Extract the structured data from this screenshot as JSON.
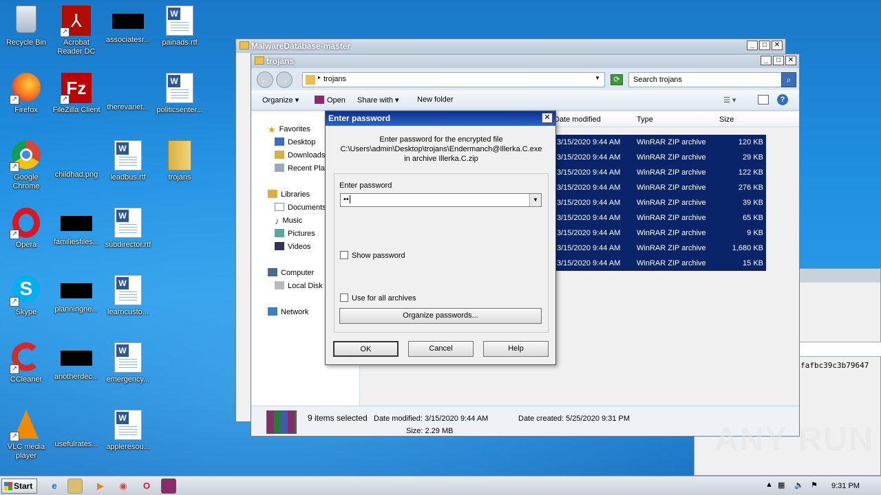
{
  "desktop_icons": [
    {
      "label": "Recycle Bin"
    },
    {
      "label": "Acrobat Reader DC"
    },
    {
      "label": "associatesr..."
    },
    {
      "label": "painads.rtf"
    },
    {
      "label": "Firefox"
    },
    {
      "label": "FileZilla Client"
    },
    {
      "label": "therevariet..."
    },
    {
      "label": "politicsenter..."
    },
    {
      "label": "Google Chrome"
    },
    {
      "label": "childhad.png"
    },
    {
      "label": "leadbus.rtf"
    },
    {
      "label": "trojans"
    },
    {
      "label": "Opera"
    },
    {
      "label": "familiesfiles..."
    },
    {
      "label": "subdirector.rtf"
    },
    {
      "label": "Skype"
    },
    {
      "label": "planningne..."
    },
    {
      "label": "learncusto..."
    },
    {
      "label": "CCleaner"
    },
    {
      "label": "anotherdec..."
    },
    {
      "label": "emergency..."
    },
    {
      "label": "VLC media player"
    },
    {
      "label": "usefulrates..."
    },
    {
      "label": "appleresou..."
    }
  ],
  "back_window": {
    "title": "MalwareDatabase-master"
  },
  "explorer": {
    "title": "trojans",
    "address": "trojans",
    "search_placeholder": "Search trojans",
    "toolbar": {
      "organize": "Organize",
      "open": "Open",
      "share_with": "Share with",
      "new_folder": "New folder"
    },
    "nav": {
      "favorites": "Favorites",
      "desktop": "Desktop",
      "downloads": "Downloads",
      "recent": "Recent Plac",
      "libraries": "Libraries",
      "documents": "Documents",
      "music": "Music",
      "pictures": "Pictures",
      "videos": "Videos",
      "computer": "Computer",
      "local_disk": "Local Disk (",
      "network": "Network"
    },
    "columns": {
      "date_modified": "Date modified",
      "type": "Type",
      "size": "Size"
    },
    "rows": [
      {
        "date": "3/15/2020 9:44 AM",
        "type": "WinRAR ZIP archive",
        "size": "120 KB"
      },
      {
        "date": "3/15/2020 9:44 AM",
        "type": "WinRAR ZIP archive",
        "size": "29 KB"
      },
      {
        "date": "3/15/2020 9:44 AM",
        "type": "WinRAR ZIP archive",
        "size": "122 KB"
      },
      {
        "date": "3/15/2020 9:44 AM",
        "type": "WinRAR ZIP archive",
        "size": "276 KB"
      },
      {
        "date": "3/15/2020 9:44 AM",
        "type": "WinRAR ZIP archive",
        "size": "39 KB"
      },
      {
        "date": "3/15/2020 9:44 AM",
        "type": "WinRAR ZIP archive",
        "size": "65 KB"
      },
      {
        "date": "3/15/2020 9:44 AM",
        "type": "WinRAR ZIP archive",
        "size": "9 KB"
      },
      {
        "date": "3/15/2020 9:44 AM",
        "type": "WinRAR ZIP archive",
        "size": "1,680 KB"
      },
      {
        "date": "3/15/2020 9:44 AM",
        "type": "WinRAR ZIP archive",
        "size": "15 KB"
      }
    ],
    "details": {
      "selected": "9 items selected",
      "date_modified": "Date modified: 3/15/2020 9:44 AM",
      "date_created": "Date created: 5/25/2020 9:31 PM",
      "size": "Size: 2.29 MB"
    }
  },
  "dialog": {
    "title": "Enter password",
    "message_line1": "Enter password for the encrypted file",
    "message_line2": "C:\\Users\\admin\\Desktop\\trojans\\Endermanch@Illerka.C.exe",
    "message_line3": "in archive Illerka.C.zip",
    "password_label": "Enter password",
    "password_value": "••",
    "show_password": "Show password",
    "use_for_all": "Use for all archives",
    "organize_passwords": "Organize passwords...",
    "ok": "OK",
    "cancel": "Cancel",
    "help": "Help"
  },
  "background_text": "fafbc39c3b79647",
  "taskbar": {
    "start": "Start",
    "clock": "9:31 PM"
  },
  "watermark": "ANY RUN"
}
